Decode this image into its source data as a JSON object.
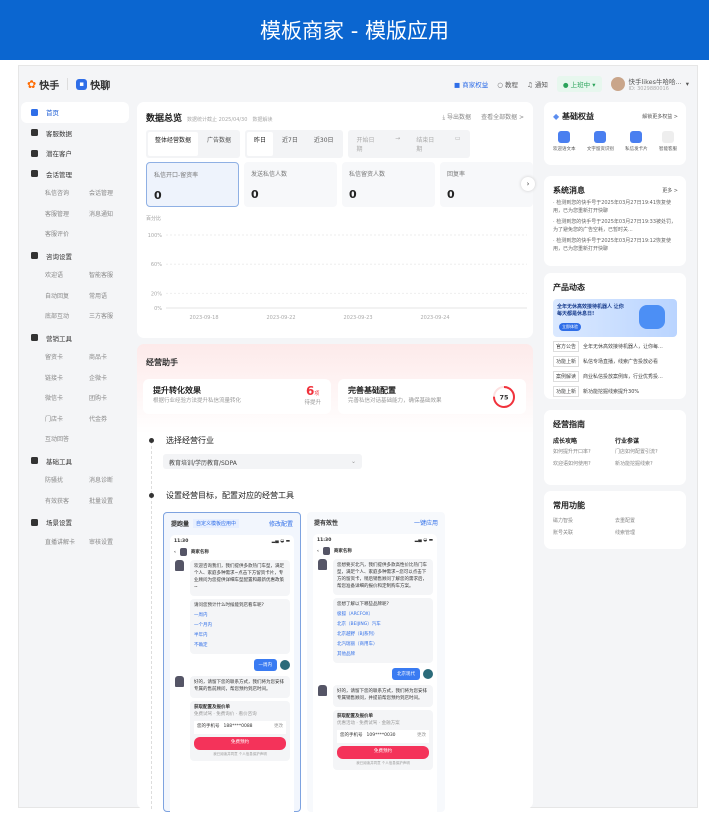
{
  "banner": {
    "title": "模板商家 - 模版应用"
  },
  "topnav": {
    "brand1": "快手",
    "brand2": "快聊",
    "merchant_rights": "商家权益",
    "tutorial": "教程",
    "notify": "通知",
    "status": "上班中",
    "user_name": "快手likes牛哈哈...",
    "user_id": "ID: 3029880016"
  },
  "sidebar": {
    "items": [
      {
        "label": "首页",
        "subs": []
      },
      {
        "label": "客服数据",
        "subs": []
      },
      {
        "label": "潜在客户",
        "subs": []
      },
      {
        "label": "会话管理",
        "subs": [
          "私信咨询",
          "会话管理",
          "客服管理",
          "消息通知",
          "客服评价"
        ]
      },
      {
        "label": "咨询设置",
        "subs": [
          "欢迎语",
          "智能客服",
          "自动回复",
          "常用语",
          "底部互动",
          "三方客服"
        ]
      },
      {
        "label": "营销工具",
        "subs": [
          "留资卡",
          "商品卡",
          "链接卡",
          "企微卡",
          "微信卡",
          "团购卡",
          "门店卡",
          "代金券",
          "互动回答"
        ]
      },
      {
        "label": "基础工具",
        "subs": [
          "防骚扰",
          "消息诊断",
          "有效获客",
          "批量设置"
        ]
      },
      {
        "label": "场景设置",
        "subs": [
          "直播讲解卡",
          "审核设置"
        ]
      }
    ]
  },
  "overview": {
    "title": "数据总览",
    "note": "数据统计截止 2025/04/30",
    "note2": "数据解读",
    "export": "导出数据",
    "view_all": "查看全部数据 >",
    "tabs": [
      "整体经营数据",
      "广告数据"
    ],
    "ranges": [
      "昨日",
      "近7日",
      "近30日"
    ],
    "start": "开始日期",
    "end": "结束日期",
    "metrics": [
      {
        "label": "私信开口-留资率",
        "value": "0"
      },
      {
        "label": "发送私信人数",
        "value": "0"
      },
      {
        "label": "私信留资人数",
        "value": "0"
      },
      {
        "label": "回复率",
        "value": "0"
      }
    ]
  },
  "chart_data": {
    "type": "line",
    "ylabel": "百分比",
    "y_ticks": [
      "100%",
      "60%",
      "20%",
      "0%"
    ],
    "categories": [
      "2023-09-18",
      "2023-09-22",
      "2023-09-23",
      "2023-09-24"
    ],
    "series": [],
    "ylim": [
      0,
      100
    ],
    "grid": true
  },
  "assistant": {
    "title": "经营助手",
    "card1": {
      "title": "提升转化效果",
      "desc": "根据行业经验方法提升私信流量转化",
      "count": "6",
      "unit": "项",
      "sub": "待提升"
    },
    "card2": {
      "title": "完善基础配置",
      "desc": "完善私信对话基础能力，确保基础效果",
      "score": "75",
      "score_fraction": 0.75
    },
    "step1": "选择经营行业",
    "industry": "教育培训/学历教育/SDPA",
    "step2": "设置经营目标，配置对应的经营工具",
    "tool1": {
      "name": "提跑量",
      "tag": "自定义模板应用中",
      "action": "修改配置"
    },
    "tool2": {
      "name": "提有效性",
      "action": "一键应用"
    },
    "phone1": {
      "time": "11:30",
      "merchant": "商家名称",
      "welcome": "欢迎咨询我们，我们提供多款热门车型，满足个人、家庭多种需求~点击下方留资卡片，专业顾问为您提供详细车型配置和最新优惠政策~",
      "question": "请问您预计什么时候能到店看车呢?",
      "options": [
        "一周内",
        "一个月内",
        "半年内",
        "不确定"
      ],
      "reply": "一周内",
      "answer": "好的，请留下您的联系方式，我们将为您安排专属的售前顾问，帮您预约到店时间。",
      "form_title": "获取配置及报价单",
      "radios": "免费试驾 · 免费询价 · 看价咨询",
      "phone_label": "您的手机号",
      "phone": "188****0088",
      "change": "更改",
      "button": "免费预约",
      "agree": "我已阅读并同意 个人信息保护声明"
    },
    "phone2": {
      "time": "11:30",
      "merchant": "商家名称",
      "welcome": "您想要买北汽，我们提供多款高性价比热门车型，满足个人、家庭多种需求~您可以点击下方的留资卡，稍后销售顾问了解您的需求后，帮您准备详细的报价和定制购车方案。",
      "question": "您想了解以下哪些品牌呢?",
      "options": [
        "极狐（ARCFOX）",
        "北京（BEIJING）汽车",
        "北京越野（BJ系列）",
        "北汽瑞丽（商用车）",
        "其他品牌"
      ],
      "reply": "北京现代",
      "answer": "好的，请留下您的联系方式，我们将为您安排专属销售顾问，并提前帮您预约到店时间。",
      "form_title": "获取配置及报价单",
      "radios": "优惠活动 · 免费试驾 · 金融方案",
      "phone_label": "您的手机号",
      "phone": "109****0030",
      "change": "更改",
      "button": "免费预约",
      "agree": "我已阅读并同意 个人信息保护声明"
    }
  },
  "rights": {
    "title": "基础权益",
    "more": "解锁更多权益 >",
    "items": [
      "欢迎语文本",
      "文字留资识别",
      "私信发卡片",
      "智能客服"
    ]
  },
  "messages": {
    "title": "系统消息",
    "more": "更多 >",
    "items": [
      "检测到您的快手号于2025年03月27日19:41恢复使用，已为您重新打开快聊",
      "检测到您的快手号于2025年03月27日19:33被处罚，为了避免您的广告空耗，已暂时关...",
      "检测到您的快手号于2025年03月27日19:12恢复使用，已为您重新打开快聊"
    ]
  },
  "product": {
    "title": "产品动态",
    "banner_title": "全年无休高效接待机器人 让你每天都是休息日!",
    "banner_btn": "立即体验",
    "items": [
      {
        "tag": "官方公告",
        "text": "全年无休高效接待机器人，让你每..."
      },
      {
        "tag": "功能上新",
        "text": "私信专场直播，线索广告投放必看"
      },
      {
        "tag": "案例解读",
        "text": "商业私信投放案例库，行业优秀投..."
      },
      {
        "tag": "功能上新",
        "text": "新功能挖掘线索提升30%"
      }
    ]
  },
  "guide": {
    "title": "经营指南",
    "col1": {
      "head": "成长攻略",
      "items": [
        "如何提升开口率?",
        "欢迎语如何使用?"
      ]
    },
    "col2": {
      "head": "行业参谋",
      "items": [
        "门店如何配置引流?",
        "新功能挖掘线索?"
      ]
    }
  },
  "common": {
    "title": "常用功能",
    "items": [
      "磁力智投",
      "去重配置",
      "账号关联",
      "线索管理"
    ]
  }
}
